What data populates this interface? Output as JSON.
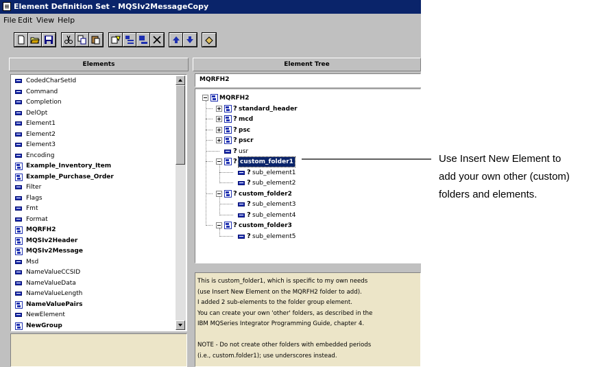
{
  "window": {
    "title": "Element Definition Set - MQSIv2MessageCopy",
    "menu": [
      "File",
      "Edit",
      "View",
      "Help"
    ]
  },
  "toolbar": {
    "buttons": [
      "new-icon",
      "open-icon",
      "save-icon",
      "cut-icon",
      "copy-icon",
      "paste-icon",
      "properties-icon",
      "insert-icon",
      "insert-element-icon",
      "delete-icon",
      "move-up-icon",
      "move-down-icon",
      "checkin-icon"
    ]
  },
  "elements_pane": {
    "header": "Elements",
    "items": [
      {
        "label": "CodedCharSetId",
        "kind": "field"
      },
      {
        "label": "Command",
        "kind": "field"
      },
      {
        "label": "Completion",
        "kind": "field"
      },
      {
        "label": "DelOpt",
        "kind": "field"
      },
      {
        "label": "Element1",
        "kind": "field"
      },
      {
        "label": "Element2",
        "kind": "field"
      },
      {
        "label": "Element3",
        "kind": "field"
      },
      {
        "label": "Encoding",
        "kind": "field"
      },
      {
        "label": "Example_Inventory_Item",
        "kind": "group"
      },
      {
        "label": "Example_Purchase_Order",
        "kind": "group"
      },
      {
        "label": "Filter",
        "kind": "field"
      },
      {
        "label": "Flags",
        "kind": "field"
      },
      {
        "label": "Fmt",
        "kind": "field"
      },
      {
        "label": "Format",
        "kind": "field"
      },
      {
        "label": "MQRFH2",
        "kind": "group"
      },
      {
        "label": "MQSIv2Header",
        "kind": "group"
      },
      {
        "label": "MQSIv2Message",
        "kind": "group"
      },
      {
        "label": "Msd",
        "kind": "field"
      },
      {
        "label": "NameValueCCSID",
        "kind": "field"
      },
      {
        "label": "NameValueData",
        "kind": "field"
      },
      {
        "label": "NameValueLength",
        "kind": "field"
      },
      {
        "label": "NameValuePairs",
        "kind": "group"
      },
      {
        "label": "NewElement",
        "kind": "field"
      },
      {
        "label": "NewGroup",
        "kind": "group"
      }
    ]
  },
  "tree_pane": {
    "header": "Element Tree",
    "path": "MQRFH2",
    "nodes": [
      {
        "label": "MQRFH2",
        "kind": "group",
        "expander": "minus",
        "q": false
      },
      {
        "label": "standard_header",
        "kind": "group",
        "expander": "plus",
        "q": true
      },
      {
        "label": "mcd",
        "kind": "group",
        "expander": "plus",
        "q": true
      },
      {
        "label": "psc",
        "kind": "group",
        "expander": "plus",
        "q": true
      },
      {
        "label": "pscr",
        "kind": "group",
        "expander": "plus",
        "q": true
      },
      {
        "label": "usr",
        "kind": "field",
        "expander": "",
        "q": true
      },
      {
        "label": "custom_folder1",
        "kind": "group",
        "expander": "minus",
        "q": true,
        "selected": true
      },
      {
        "label": "sub_element1",
        "kind": "field",
        "expander": "",
        "q": true
      },
      {
        "label": "sub_element2",
        "kind": "field",
        "expander": "",
        "q": true
      },
      {
        "label": "custom_folder2",
        "kind": "group",
        "expander": "minus",
        "q": true
      },
      {
        "label": "sub_element3",
        "kind": "field",
        "expander": "",
        "q": true
      },
      {
        "label": "sub_element4",
        "kind": "field",
        "expander": "",
        "q": true
      },
      {
        "label": "custom_folder3",
        "kind": "group",
        "expander": "minus",
        "q": true
      },
      {
        "label": "sub_element5",
        "kind": "field",
        "expander": "",
        "q": true
      }
    ],
    "description": [
      "This is custom_folder1, which is specific to my own needs",
      "(use Insert New Element on the MQRFH2 folder to add).",
      "I added 2 sub-elements to the folder group element.",
      "You can create your own 'other' folders, as described in the",
      "IBM MQSeries Integrator Programming Guide, chapter 4.",
      "",
      "NOTE - Do not create other folders with embedded periods",
      "(i.e., custom.folder1); use underscores instead."
    ]
  },
  "callout": {
    "lines": [
      "Use Insert New Element to",
      "add your own other (custom)",
      "folders and elements."
    ]
  },
  "colors": {
    "title_bar": "#0a246a",
    "selection": "#0a246a",
    "description_bg": "#ece5c8",
    "icon_blue": "#1d2fb0"
  }
}
